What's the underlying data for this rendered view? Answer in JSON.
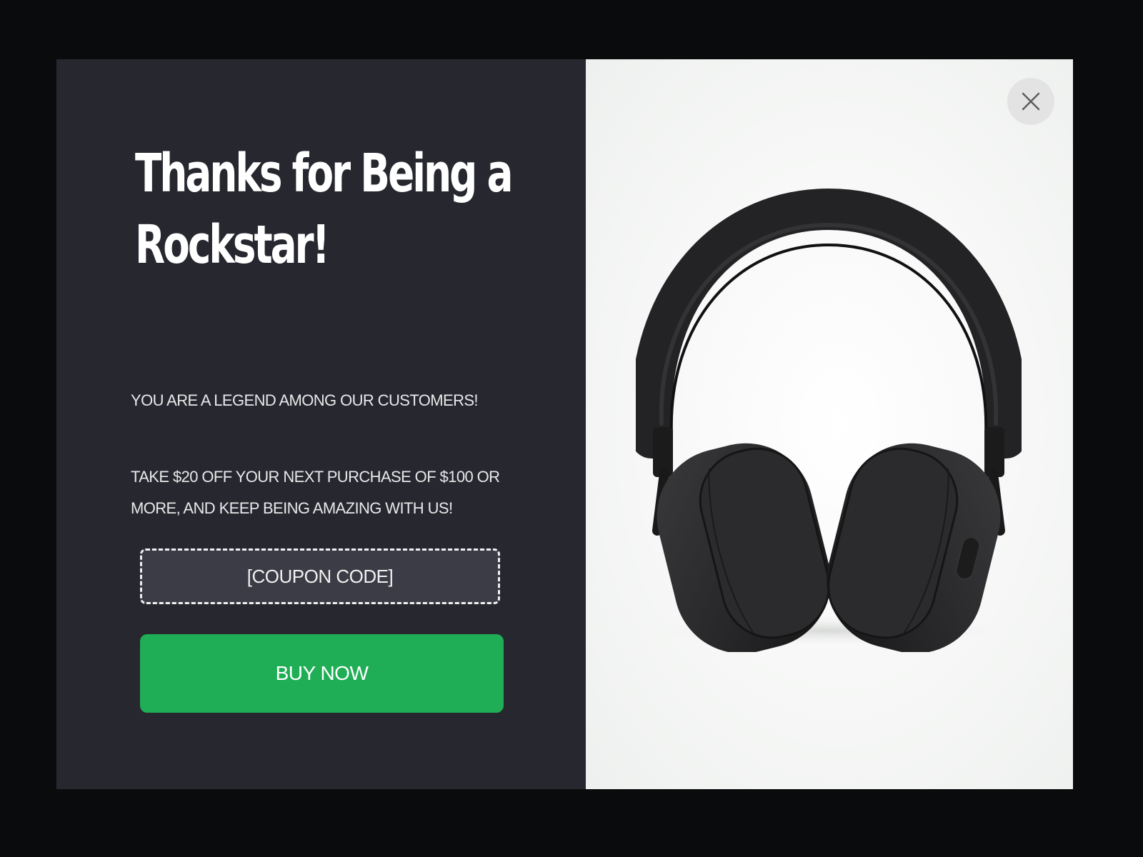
{
  "popup": {
    "headline": "Thanks for Being a Rockstar!",
    "subtext_1": "YOU ARE A LEGEND AMONG OUR CUSTOMERS!",
    "subtext_2": "TAKE $20 OFF YOUR NEXT PURCHASE OF $100 OR MORE, AND KEEP BEING AMAZING WITH US!",
    "coupon_code": "[COUPON CODE]",
    "buy_button_label": "BUY NOW",
    "close_icon": "close-icon",
    "product_image": "headphones-image"
  },
  "colors": {
    "panel_dark": "#27282f",
    "coupon_bg": "#3b3c45",
    "accent_green": "#1fad55",
    "overlay": "#0a0b0c"
  }
}
